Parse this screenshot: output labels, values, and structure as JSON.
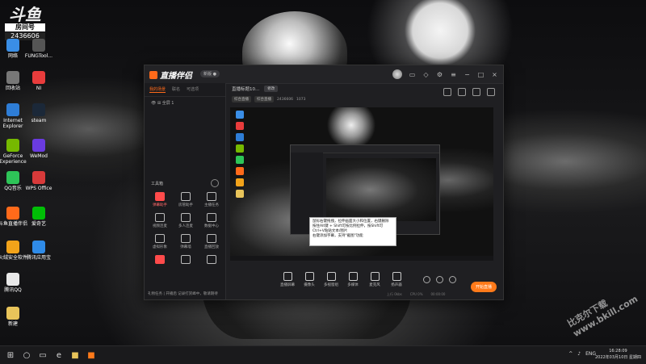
{
  "desktop": {
    "badge": {
      "logo": "斗鱼",
      "room_label": "房间号",
      "room_number": "2436606"
    },
    "icons": [
      {
        "label": "网络",
        "color": "#3a8ee6"
      },
      {
        "label": "FUNGTool...",
        "color": "#555"
      },
      {
        "label": "回收站",
        "color": "#777"
      },
      {
        "label": "NI",
        "color": "#e83c3c"
      },
      {
        "label": "Internet Explorer",
        "color": "#2e7dd6"
      },
      {
        "label": "steam",
        "color": "#1b2838"
      },
      {
        "label": "GeForce Experience",
        "color": "#76b900"
      },
      {
        "label": "WeMod",
        "color": "#6a3be0"
      },
      {
        "label": "QQ音乐",
        "color": "#2ec458"
      },
      {
        "label": "WPS Office",
        "color": "#d83a3a"
      },
      {
        "label": "斗鱼直播伴侣",
        "color": "#ff6a1a"
      },
      {
        "label": "爱奇艺",
        "color": "#00be06"
      },
      {
        "label": "火绒安全软件",
        "color": "#f2a31a"
      },
      {
        "label": "腾讯应用宝",
        "color": "#2f8be8"
      },
      {
        "label": "腾讯QQ",
        "color": "#e8e8e8"
      },
      {
        "label": "新建",
        "color": "#e8c45a"
      }
    ]
  },
  "app": {
    "title": "直播伴侣",
    "version": "新版 ●",
    "left_tabs": [
      "我的场景",
      "联名",
      "可选项"
    ],
    "scene_label": "全屏 1",
    "tools_title": "工具箱",
    "tools": [
      {
        "label": "弹幕助手",
        "hot": true
      },
      {
        "label": "房管助手",
        "hot": false
      },
      {
        "label": "主播任务",
        "hot": false
      },
      {
        "label": "视频连麦",
        "hot": false
      },
      {
        "label": "多人连麦",
        "hot": false
      },
      {
        "label": "数据中心",
        "hot": false
      },
      {
        "label": "虚拟形象",
        "hot": false
      },
      {
        "label": "弹幕墙",
        "hot": false
      },
      {
        "label": "直播回放",
        "hot": false
      },
      {
        "label": "",
        "hot": true
      },
      {
        "label": "",
        "hot": false
      },
      {
        "label": "",
        "hot": false
      }
    ],
    "notice": "礼物任务 | 开播后 记录打赏峰中，敬请期待",
    "stream_title": "直播标题10...",
    "edit_label": "修改",
    "tags": [
      "综合直播",
      "综合直播"
    ],
    "room_id": "2436606",
    "follower_count": "1073",
    "controls": [
      {
        "label": "直播屏幕"
      },
      {
        "label": "摄像头"
      },
      {
        "label": "多视窗组"
      },
      {
        "label": "多媒体"
      },
      {
        "label": "麦克风"
      },
      {
        "label": "扬声器"
      }
    ],
    "start_button": "开始直播",
    "status": [
      "上行 0kbs",
      "CPU 0%",
      "00:00:00"
    ]
  },
  "tooltip": {
    "lines": [
      "鼠标右键拖拽，拉伸画面大小和位置，右键删除",
      "按住Alt键 + Shift可按比例拉伸，按Shift可",
      "Ctrl+V粘贴文本/图片",
      "右键添加字幕，支持\"截图\"功能"
    ]
  },
  "taskbar": {
    "lang": "ENG",
    "time": "16:28:09",
    "date": "2022年03月10日 星期四"
  },
  "watermark": "比克尔下载 www.bkill.com"
}
